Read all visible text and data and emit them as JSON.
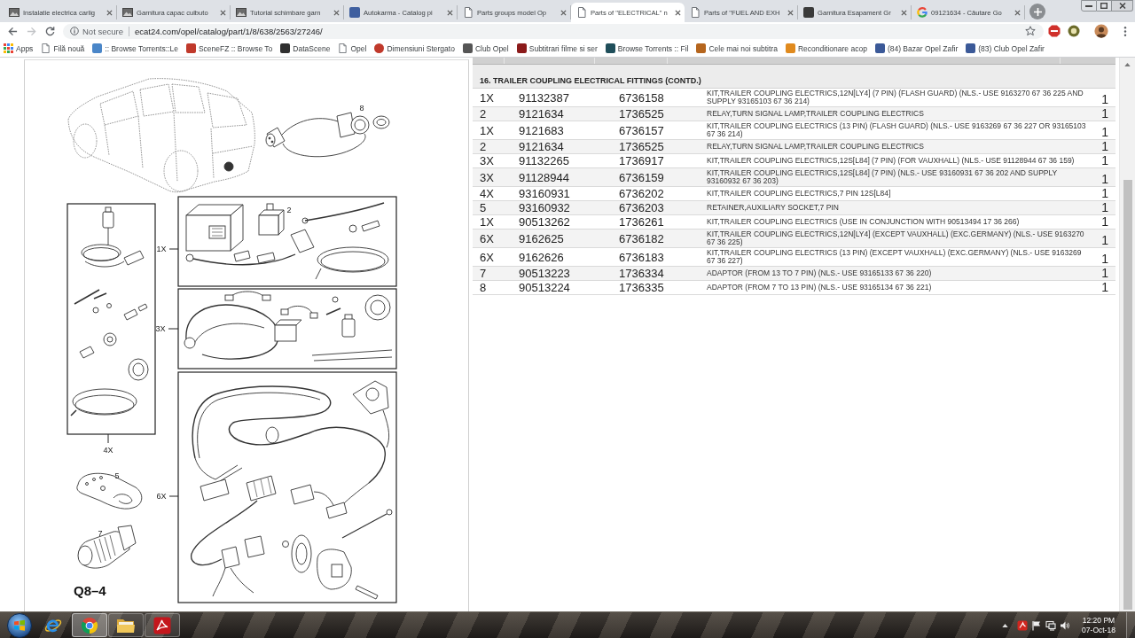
{
  "browser": {
    "tabs": [
      {
        "title": "Instalatie electrica carlig",
        "kind": "thumbnail",
        "selected": false
      },
      {
        "title": "Garnitura capac culbuto",
        "kind": "thumbnail",
        "selected": false
      },
      {
        "title": "Tutorial schimbare garn",
        "kind": "thumbnail",
        "selected": false
      },
      {
        "title": "Autokarma - Catalog pi",
        "kind": "square",
        "color": "#3f5f9f",
        "selected": false
      },
      {
        "title": "Parts groups model Op",
        "kind": "page",
        "selected": false
      },
      {
        "title": "Parts of \"ELECTRICAL\" n",
        "kind": "page",
        "selected": true
      },
      {
        "title": "Parts of \"FUEL AND EXH",
        "kind": "page",
        "selected": false
      },
      {
        "title": "Garnitura Esapament Gr",
        "kind": "square",
        "color": "#3a3a3a",
        "selected": false
      },
      {
        "title": "09121634 - Căutare Go",
        "kind": "google",
        "selected": false
      }
    ],
    "nav": [
      {
        "kind": "back",
        "disabled": false
      },
      {
        "kind": "forward",
        "disabled": true
      },
      {
        "kind": "reload",
        "disabled": false
      }
    ],
    "omnibox": {
      "security": "Not secure",
      "url": "ecat24.com/opel/catalog/part/1/8/638/2563/27246/",
      "bookmarked": false
    },
    "bookmarks": [
      {
        "label": "Apps",
        "kind": "apps"
      },
      {
        "label": "Filă nouă",
        "kind": "page"
      },
      {
        "label": ":: Browse Torrents::Le",
        "kind": "square",
        "color": "#4a86c8"
      },
      {
        "label": "SceneFZ :: Browse To",
        "kind": "square",
        "color": "#c0392b"
      },
      {
        "label": "DataScene",
        "kind": "square",
        "color": "#2f2f2f"
      },
      {
        "label": "Opel",
        "kind": "page"
      },
      {
        "label": "Dimensiuni Stergato",
        "kind": "circle",
        "color": "#c0392b"
      },
      {
        "label": "Club Opel",
        "kind": "square",
        "color": "#555555"
      },
      {
        "label": "Subtitrari filme si ser",
        "kind": "square",
        "color": "#8b1a1a"
      },
      {
        "label": "Browse Torrents :: Fil",
        "kind": "square",
        "color": "#1f4e5a"
      },
      {
        "label": "Cele mai noi subtitra",
        "kind": "square",
        "color": "#b5651d"
      },
      {
        "label": "Reconditionare acop",
        "kind": "square",
        "color": "#e08a1e"
      },
      {
        "label": "(84) Bazar Opel Zafir",
        "kind": "square",
        "color": "#3b5998"
      },
      {
        "label": "(83) Club Opel Zafir",
        "kind": "square",
        "color": "#3b5998"
      }
    ]
  },
  "diagram": {
    "callouts": [
      "8",
      "2",
      "1X",
      "3X",
      "4X",
      "5",
      "6X",
      "7"
    ],
    "code": "Q8–4"
  },
  "parts_table": {
    "section": "16. TRAILER COUPLING ELECTRICAL FITTINGS (CONTD.)",
    "rows": [
      {
        "ref": "1X",
        "part_no": "91132387",
        "catalog_no": "6736158",
        "description": "KIT,TRAILER COUPLING ELECTRICS,12N[LY4] (7 PIN) (FLASH GUARD) (NLS.- USE 9163270 67 36 225 AND SUPPLY 93165103 67 36 214)",
        "qty": "1"
      },
      {
        "ref": "2",
        "part_no": "9121634",
        "catalog_no": "1736525",
        "description": "RELAY,TURN SIGNAL LAMP,TRAILER COUPLING ELECTRICS",
        "qty": "1"
      },
      {
        "ref": "1X",
        "part_no": "9121683",
        "catalog_no": "6736157",
        "description": "KIT,TRAILER COUPLING ELECTRICS (13 PIN) (FLASH GUARD) (NLS.- USE 9163269 67 36 227 OR 93165103 67 36 214)",
        "qty": "1"
      },
      {
        "ref": "2",
        "part_no": "9121634",
        "catalog_no": "1736525",
        "description": "RELAY,TURN SIGNAL LAMP,TRAILER COUPLING ELECTRICS",
        "qty": "1"
      },
      {
        "ref": "3X",
        "part_no": "91132265",
        "catalog_no": "1736917",
        "description": "KIT,TRAILER COUPLING ELECTRICS,12S[L84] (7 PIN) (FOR VAUXHALL) (NLS.- USE 91128944 67 36 159)",
        "qty": "1"
      },
      {
        "ref": "3X",
        "part_no": "91128944",
        "catalog_no": "6736159",
        "description": "KIT,TRAILER COUPLING ELECTRICS,12S[L84] (7 PIN) (NLS.- USE 93160931 67 36 202 AND SUPPLY 93160932 67 36 203)",
        "qty": "1"
      },
      {
        "ref": "4X",
        "part_no": "93160931",
        "catalog_no": "6736202",
        "description": "KIT,TRAILER COUPLING ELECTRICS,7 PIN 12S[L84]",
        "qty": "1"
      },
      {
        "ref": "5",
        "part_no": "93160932",
        "catalog_no": "6736203",
        "description": "RETAINER,AUXILIARY SOCKET,7 PIN",
        "qty": "1"
      },
      {
        "ref": "1X",
        "part_no": "90513262",
        "catalog_no": "1736261",
        "description": "KIT,TRAILER COUPLING ELECTRICS (USE IN CONJUNCTION WITH 90513494 17 36 266)",
        "qty": "1"
      },
      {
        "ref": "6X",
        "part_no": "9162625",
        "catalog_no": "6736182",
        "description": "KIT,TRAILER COUPLING ELECTRICS,12N[LY4] (EXCEPT VAUXHALL) (EXC.GERMANY) (NLS.- USE 9163270 67 36 225)",
        "qty": "1"
      },
      {
        "ref": "6X",
        "part_no": "9162626",
        "catalog_no": "6736183",
        "description": "KIT,TRAILER COUPLING ELECTRICS (13 PIN) (EXCEPT VAUXHALL) (EXC.GERMANY) (NLS.- USE 9163269 67 36 227)",
        "qty": "1"
      },
      {
        "ref": "7",
        "part_no": "90513223",
        "catalog_no": "1736334",
        "description": "ADAPTOR (FROM 13 TO 7 PIN) (NLS.- USE 93165133 67 36 220)",
        "qty": "1"
      },
      {
        "ref": "8",
        "part_no": "90513224",
        "catalog_no": "1736335",
        "description": "ADAPTOR (FROM 7 TO 13 PIN) (NLS.- USE 93165134 67 36 221)",
        "qty": "1"
      }
    ]
  },
  "taskbar": {
    "apps": [
      {
        "kind": "ie",
        "running": false,
        "selected": false
      },
      {
        "kind": "chrome",
        "running": true,
        "selected": true
      },
      {
        "kind": "explorer",
        "running": true,
        "selected": false
      },
      {
        "kind": "acrobat",
        "running": true,
        "selected": false
      }
    ],
    "time": "12:20 PM",
    "date": "07-Oct-18"
  }
}
